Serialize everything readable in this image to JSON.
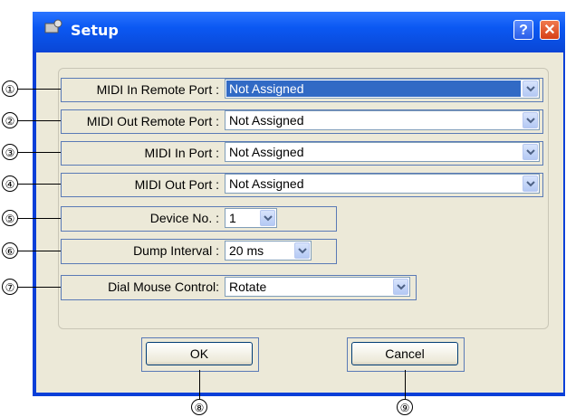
{
  "window": {
    "title": "Setup",
    "help_label": "?",
    "close_label": "✕"
  },
  "rows": [
    {
      "label": "MIDI In Remote Port :",
      "value": "Not Assigned"
    },
    {
      "label": "MIDI Out Remote Port :",
      "value": "Not Assigned"
    },
    {
      "label": "MIDI In Port :",
      "value": "Not Assigned"
    },
    {
      "label": "MIDI Out Port :",
      "value": "Not Assigned"
    },
    {
      "label": "Device No. :",
      "value": "1"
    },
    {
      "label": "Dump Interval :",
      "value": "20 ms"
    },
    {
      "label": "Dial Mouse Control:",
      "value": "Rotate"
    }
  ],
  "buttons": {
    "ok": "OK",
    "cancel": "Cancel"
  },
  "callouts": [
    "①",
    "②",
    "③",
    "④",
    "⑤",
    "⑥",
    "⑦",
    "⑧",
    "⑨"
  ]
}
